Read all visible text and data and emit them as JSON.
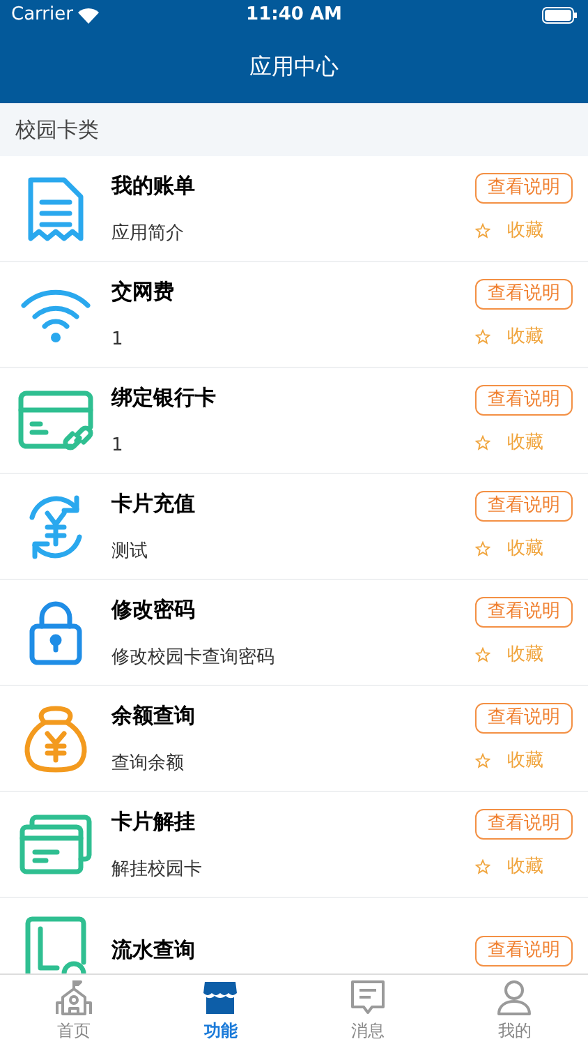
{
  "status_bar": {
    "carrier": "Carrier",
    "time": "11:40 AM"
  },
  "nav": {
    "title": "应用中心"
  },
  "section": {
    "title": "校园卡类"
  },
  "apps": [
    {
      "kind": "bill",
      "title": "我的账单",
      "subtitle": "应用简介",
      "button": "查看说明",
      "favorite": {
        "label": "收藏",
        "favorited": false
      }
    },
    {
      "kind": "wifi",
      "title": "交网费",
      "subtitle": "1",
      "button": "查看说明",
      "favorite": {
        "label": "收藏",
        "favorited": false
      }
    },
    {
      "kind": "bank-card",
      "title": "绑定银行卡",
      "subtitle": "1",
      "button": "查看说明",
      "favorite": {
        "label": "收藏",
        "favorited": false
      }
    },
    {
      "kind": "recharge",
      "title": "卡片充值",
      "subtitle": "测试",
      "button": "查看说明",
      "favorite": {
        "label": "收藏",
        "favorited": false
      }
    },
    {
      "kind": "lock",
      "title": "修改密码",
      "subtitle": "修改校园卡查询密码",
      "button": "查看说明",
      "favorite": {
        "label": "收藏",
        "favorited": false
      }
    },
    {
      "kind": "money-bag",
      "title": "余额查询",
      "subtitle": "查询余额",
      "button": "查看说明",
      "favorite": {
        "label": "收藏",
        "favorited": false
      }
    },
    {
      "kind": "cards",
      "title": "卡片解挂",
      "subtitle": "解挂校园卡",
      "button": "查看说明",
      "favorite": {
        "label": "收藏",
        "favorited": false
      }
    },
    {
      "kind": "ledger",
      "title": "流水查询",
      "button": "查看说明"
    }
  ],
  "tabs": [
    {
      "kind": "home",
      "label": "首页",
      "selected": false
    },
    {
      "kind": "store",
      "label": "功能",
      "selected": true
    },
    {
      "kind": "message",
      "label": "消息",
      "selected": false
    },
    {
      "kind": "profile",
      "label": "我的",
      "selected": false
    }
  ]
}
